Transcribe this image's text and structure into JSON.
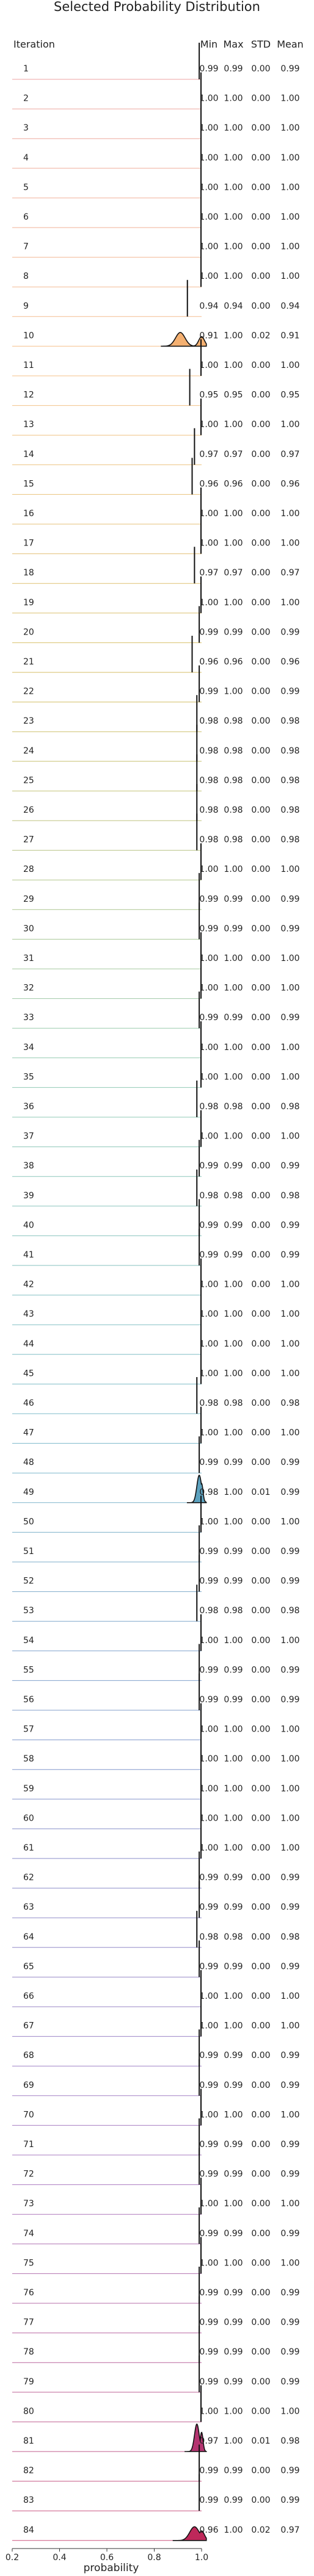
{
  "chart_data": {
    "type": "ridgeline",
    "title": "Selected Probability Distribution",
    "xlabel": "probability",
    "row_header": "Iteration",
    "column_headers": [
      "Min",
      "Max",
      "STD",
      "Mean"
    ],
    "xlim": [
      0.2,
      1.0
    ],
    "xticks": [
      "0.2",
      "0.4",
      "0.6",
      "0.8",
      "1.0"
    ],
    "rows": [
      {
        "iteration": "1",
        "stats": [
          "0.99",
          "0.99",
          "0.00",
          "0.99"
        ]
      },
      {
        "iteration": "2",
        "stats": [
          "1.00",
          "1.00",
          "0.00",
          "1.00"
        ]
      },
      {
        "iteration": "3",
        "stats": [
          "1.00",
          "1.00",
          "0.00",
          "1.00"
        ]
      },
      {
        "iteration": "4",
        "stats": [
          "1.00",
          "1.00",
          "0.00",
          "1.00"
        ]
      },
      {
        "iteration": "5",
        "stats": [
          "1.00",
          "1.00",
          "0.00",
          "1.00"
        ]
      },
      {
        "iteration": "6",
        "stats": [
          "1.00",
          "1.00",
          "0.00",
          "1.00"
        ]
      },
      {
        "iteration": "7",
        "stats": [
          "1.00",
          "1.00",
          "0.00",
          "1.00"
        ]
      },
      {
        "iteration": "8",
        "stats": [
          "1.00",
          "1.00",
          "0.00",
          "1.00"
        ]
      },
      {
        "iteration": "9",
        "stats": [
          "0.94",
          "0.94",
          "0.00",
          "0.94"
        ]
      },
      {
        "iteration": "10",
        "stats": [
          "0.91",
          "1.00",
          "0.02",
          "0.91"
        ]
      },
      {
        "iteration": "11",
        "stats": [
          "1.00",
          "1.00",
          "0.00",
          "1.00"
        ]
      },
      {
        "iteration": "12",
        "stats": [
          "0.95",
          "0.95",
          "0.00",
          "0.95"
        ]
      },
      {
        "iteration": "13",
        "stats": [
          "1.00",
          "1.00",
          "0.00",
          "1.00"
        ]
      },
      {
        "iteration": "14",
        "stats": [
          "0.97",
          "0.97",
          "0.00",
          "0.97"
        ]
      },
      {
        "iteration": "15",
        "stats": [
          "0.96",
          "0.96",
          "0.00",
          "0.96"
        ]
      },
      {
        "iteration": "16",
        "stats": [
          "1.00",
          "1.00",
          "0.00",
          "1.00"
        ]
      },
      {
        "iteration": "17",
        "stats": [
          "1.00",
          "1.00",
          "0.00",
          "1.00"
        ]
      },
      {
        "iteration": "18",
        "stats": [
          "0.97",
          "0.97",
          "0.00",
          "0.97"
        ]
      },
      {
        "iteration": "19",
        "stats": [
          "1.00",
          "1.00",
          "0.00",
          "1.00"
        ]
      },
      {
        "iteration": "20",
        "stats": [
          "0.99",
          "0.99",
          "0.00",
          "0.99"
        ]
      },
      {
        "iteration": "21",
        "stats": [
          "0.96",
          "0.96",
          "0.00",
          "0.96"
        ]
      },
      {
        "iteration": "22",
        "stats": [
          "0.99",
          "1.00",
          "0.00",
          "0.99"
        ]
      },
      {
        "iteration": "23",
        "stats": [
          "0.98",
          "0.98",
          "0.00",
          "0.98"
        ]
      },
      {
        "iteration": "24",
        "stats": [
          "0.98",
          "0.98",
          "0.00",
          "0.98"
        ]
      },
      {
        "iteration": "25",
        "stats": [
          "0.98",
          "0.98",
          "0.00",
          "0.98"
        ]
      },
      {
        "iteration": "26",
        "stats": [
          "0.98",
          "0.98",
          "0.00",
          "0.98"
        ]
      },
      {
        "iteration": "27",
        "stats": [
          "0.98",
          "0.98",
          "0.00",
          "0.98"
        ]
      },
      {
        "iteration": "28",
        "stats": [
          "1.00",
          "1.00",
          "0.00",
          "1.00"
        ]
      },
      {
        "iteration": "29",
        "stats": [
          "0.99",
          "0.99",
          "0.00",
          "0.99"
        ]
      },
      {
        "iteration": "30",
        "stats": [
          "0.99",
          "0.99",
          "0.00",
          "0.99"
        ]
      },
      {
        "iteration": "31",
        "stats": [
          "1.00",
          "1.00",
          "0.00",
          "1.00"
        ]
      },
      {
        "iteration": "32",
        "stats": [
          "1.00",
          "1.00",
          "0.00",
          "1.00"
        ]
      },
      {
        "iteration": "33",
        "stats": [
          "0.99",
          "0.99",
          "0.00",
          "0.99"
        ]
      },
      {
        "iteration": "34",
        "stats": [
          "1.00",
          "1.00",
          "0.00",
          "1.00"
        ]
      },
      {
        "iteration": "35",
        "stats": [
          "1.00",
          "1.00",
          "0.00",
          "1.00"
        ]
      },
      {
        "iteration": "36",
        "stats": [
          "0.98",
          "0.98",
          "0.00",
          "0.98"
        ]
      },
      {
        "iteration": "37",
        "stats": [
          "1.00",
          "1.00",
          "0.00",
          "1.00"
        ]
      },
      {
        "iteration": "38",
        "stats": [
          "0.99",
          "0.99",
          "0.00",
          "0.99"
        ]
      },
      {
        "iteration": "39",
        "stats": [
          "0.98",
          "0.98",
          "0.00",
          "0.98"
        ]
      },
      {
        "iteration": "40",
        "stats": [
          "0.99",
          "0.99",
          "0.00",
          "0.99"
        ]
      },
      {
        "iteration": "41",
        "stats": [
          "0.99",
          "0.99",
          "0.00",
          "0.99"
        ]
      },
      {
        "iteration": "42",
        "stats": [
          "1.00",
          "1.00",
          "0.00",
          "1.00"
        ]
      },
      {
        "iteration": "43",
        "stats": [
          "1.00",
          "1.00",
          "0.00",
          "1.00"
        ]
      },
      {
        "iteration": "44",
        "stats": [
          "1.00",
          "1.00",
          "0.00",
          "1.00"
        ]
      },
      {
        "iteration": "45",
        "stats": [
          "1.00",
          "1.00",
          "0.00",
          "1.00"
        ]
      },
      {
        "iteration": "46",
        "stats": [
          "0.98",
          "0.98",
          "0.00",
          "0.98"
        ]
      },
      {
        "iteration": "47",
        "stats": [
          "1.00",
          "1.00",
          "0.00",
          "1.00"
        ]
      },
      {
        "iteration": "48",
        "stats": [
          "0.99",
          "0.99",
          "0.00",
          "0.99"
        ]
      },
      {
        "iteration": "49",
        "stats": [
          "0.98",
          "1.00",
          "0.01",
          "0.99"
        ]
      },
      {
        "iteration": "50",
        "stats": [
          "1.00",
          "1.00",
          "0.00",
          "1.00"
        ]
      },
      {
        "iteration": "51",
        "stats": [
          "0.99",
          "0.99",
          "0.00",
          "0.99"
        ]
      },
      {
        "iteration": "52",
        "stats": [
          "0.99",
          "0.99",
          "0.00",
          "0.99"
        ]
      },
      {
        "iteration": "53",
        "stats": [
          "0.98",
          "0.98",
          "0.00",
          "0.98"
        ]
      },
      {
        "iteration": "54",
        "stats": [
          "1.00",
          "1.00",
          "0.00",
          "1.00"
        ]
      },
      {
        "iteration": "55",
        "stats": [
          "0.99",
          "0.99",
          "0.00",
          "0.99"
        ]
      },
      {
        "iteration": "56",
        "stats": [
          "0.99",
          "0.99",
          "0.00",
          "0.99"
        ]
      },
      {
        "iteration": "57",
        "stats": [
          "1.00",
          "1.00",
          "0.00",
          "1.00"
        ]
      },
      {
        "iteration": "58",
        "stats": [
          "1.00",
          "1.00",
          "0.00",
          "1.00"
        ]
      },
      {
        "iteration": "59",
        "stats": [
          "1.00",
          "1.00",
          "0.00",
          "1.00"
        ]
      },
      {
        "iteration": "60",
        "stats": [
          "1.00",
          "1.00",
          "0.00",
          "1.00"
        ]
      },
      {
        "iteration": "61",
        "stats": [
          "1.00",
          "1.00",
          "0.00",
          "1.00"
        ]
      },
      {
        "iteration": "62",
        "stats": [
          "0.99",
          "0.99",
          "0.00",
          "0.99"
        ]
      },
      {
        "iteration": "63",
        "stats": [
          "0.99",
          "0.99",
          "0.00",
          "0.99"
        ]
      },
      {
        "iteration": "64",
        "stats": [
          "0.98",
          "0.98",
          "0.00",
          "0.98"
        ]
      },
      {
        "iteration": "65",
        "stats": [
          "0.99",
          "0.99",
          "0.00",
          "0.99"
        ]
      },
      {
        "iteration": "66",
        "stats": [
          "1.00",
          "1.00",
          "0.00",
          "1.00"
        ]
      },
      {
        "iteration": "67",
        "stats": [
          "1.00",
          "1.00",
          "0.00",
          "1.00"
        ]
      },
      {
        "iteration": "68",
        "stats": [
          "0.99",
          "0.99",
          "0.00",
          "0.99"
        ]
      },
      {
        "iteration": "69",
        "stats": [
          "0.99",
          "0.99",
          "0.00",
          "0.99"
        ]
      },
      {
        "iteration": "70",
        "stats": [
          "1.00",
          "1.00",
          "0.00",
          "1.00"
        ]
      },
      {
        "iteration": "71",
        "stats": [
          "0.99",
          "0.99",
          "0.00",
          "0.99"
        ]
      },
      {
        "iteration": "72",
        "stats": [
          "0.99",
          "0.99",
          "0.00",
          "0.99"
        ]
      },
      {
        "iteration": "73",
        "stats": [
          "1.00",
          "1.00",
          "0.00",
          "1.00"
        ]
      },
      {
        "iteration": "74",
        "stats": [
          "0.99",
          "0.99",
          "0.00",
          "0.99"
        ]
      },
      {
        "iteration": "75",
        "stats": [
          "1.00",
          "1.00",
          "0.00",
          "1.00"
        ]
      },
      {
        "iteration": "76",
        "stats": [
          "0.99",
          "0.99",
          "0.00",
          "0.99"
        ]
      },
      {
        "iteration": "77",
        "stats": [
          "0.99",
          "0.99",
          "0.00",
          "0.99"
        ]
      },
      {
        "iteration": "78",
        "stats": [
          "0.99",
          "0.99",
          "0.00",
          "0.99"
        ]
      },
      {
        "iteration": "79",
        "stats": [
          "0.99",
          "0.99",
          "0.00",
          "0.99"
        ]
      },
      {
        "iteration": "80",
        "stats": [
          "1.00",
          "1.00",
          "0.00",
          "1.00"
        ]
      },
      {
        "iteration": "81",
        "stats": [
          "0.97",
          "1.00",
          "0.01",
          "0.98"
        ]
      },
      {
        "iteration": "82",
        "stats": [
          "0.99",
          "0.99",
          "0.00",
          "0.99"
        ]
      },
      {
        "iteration": "83",
        "stats": [
          "0.99",
          "0.99",
          "0.00",
          "0.99"
        ]
      },
      {
        "iteration": "84",
        "stats": [
          "0.96",
          "1.00",
          "0.02",
          "0.97"
        ]
      }
    ]
  }
}
